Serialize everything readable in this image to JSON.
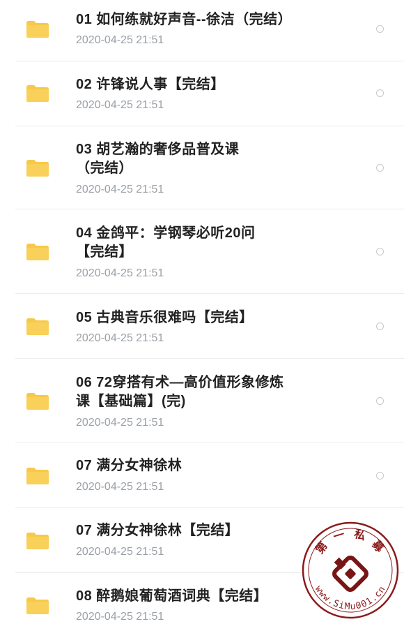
{
  "items": [
    {
      "title_lines": [
        "01 如何练就好声音--徐洁（完结）"
      ],
      "date": "2020-04-25 21:51"
    },
    {
      "title_lines": [
        "02 许锋说人事【完结】"
      ],
      "date": "2020-04-25 21:51"
    },
    {
      "title_lines": [
        "03 胡艺瀚的奢侈品普及课",
        "（完结）"
      ],
      "date": "2020-04-25 21:51"
    },
    {
      "title_lines": [
        "04 金鸽平：学钢琴必听20问",
        "【完结】"
      ],
      "date": "2020-04-25 21:51"
    },
    {
      "title_lines": [
        "05 古典音乐很难吗【完结】"
      ],
      "date": "2020-04-25 21:51"
    },
    {
      "title_lines": [
        "06 72穿搭有术—高价值形象修炼",
        "课【基础篇】(完)"
      ],
      "date": "2020-04-25 21:51"
    },
    {
      "title_lines": [
        "07 满分女神徐林"
      ],
      "date": "2020-04-25 21:51"
    },
    {
      "title_lines": [
        "07 满分女神徐林【完结】"
      ],
      "date": "2020-04-25 21:51"
    },
    {
      "title_lines": [
        "08 醉鹅娘葡萄酒词典【完结】"
      ],
      "date": "2020-04-25 21:51"
    }
  ],
  "watermark": {
    "top_text": "第 一 私 募",
    "bottom_text": "www.SiMu001.cn"
  },
  "colors": {
    "folder": "#f7c948",
    "folder_tab": "#f2b926",
    "date": "#9aa0a6",
    "title": "#222222"
  },
  "icons": {
    "folder": "folder-icon",
    "select": "radio-circle-icon"
  }
}
